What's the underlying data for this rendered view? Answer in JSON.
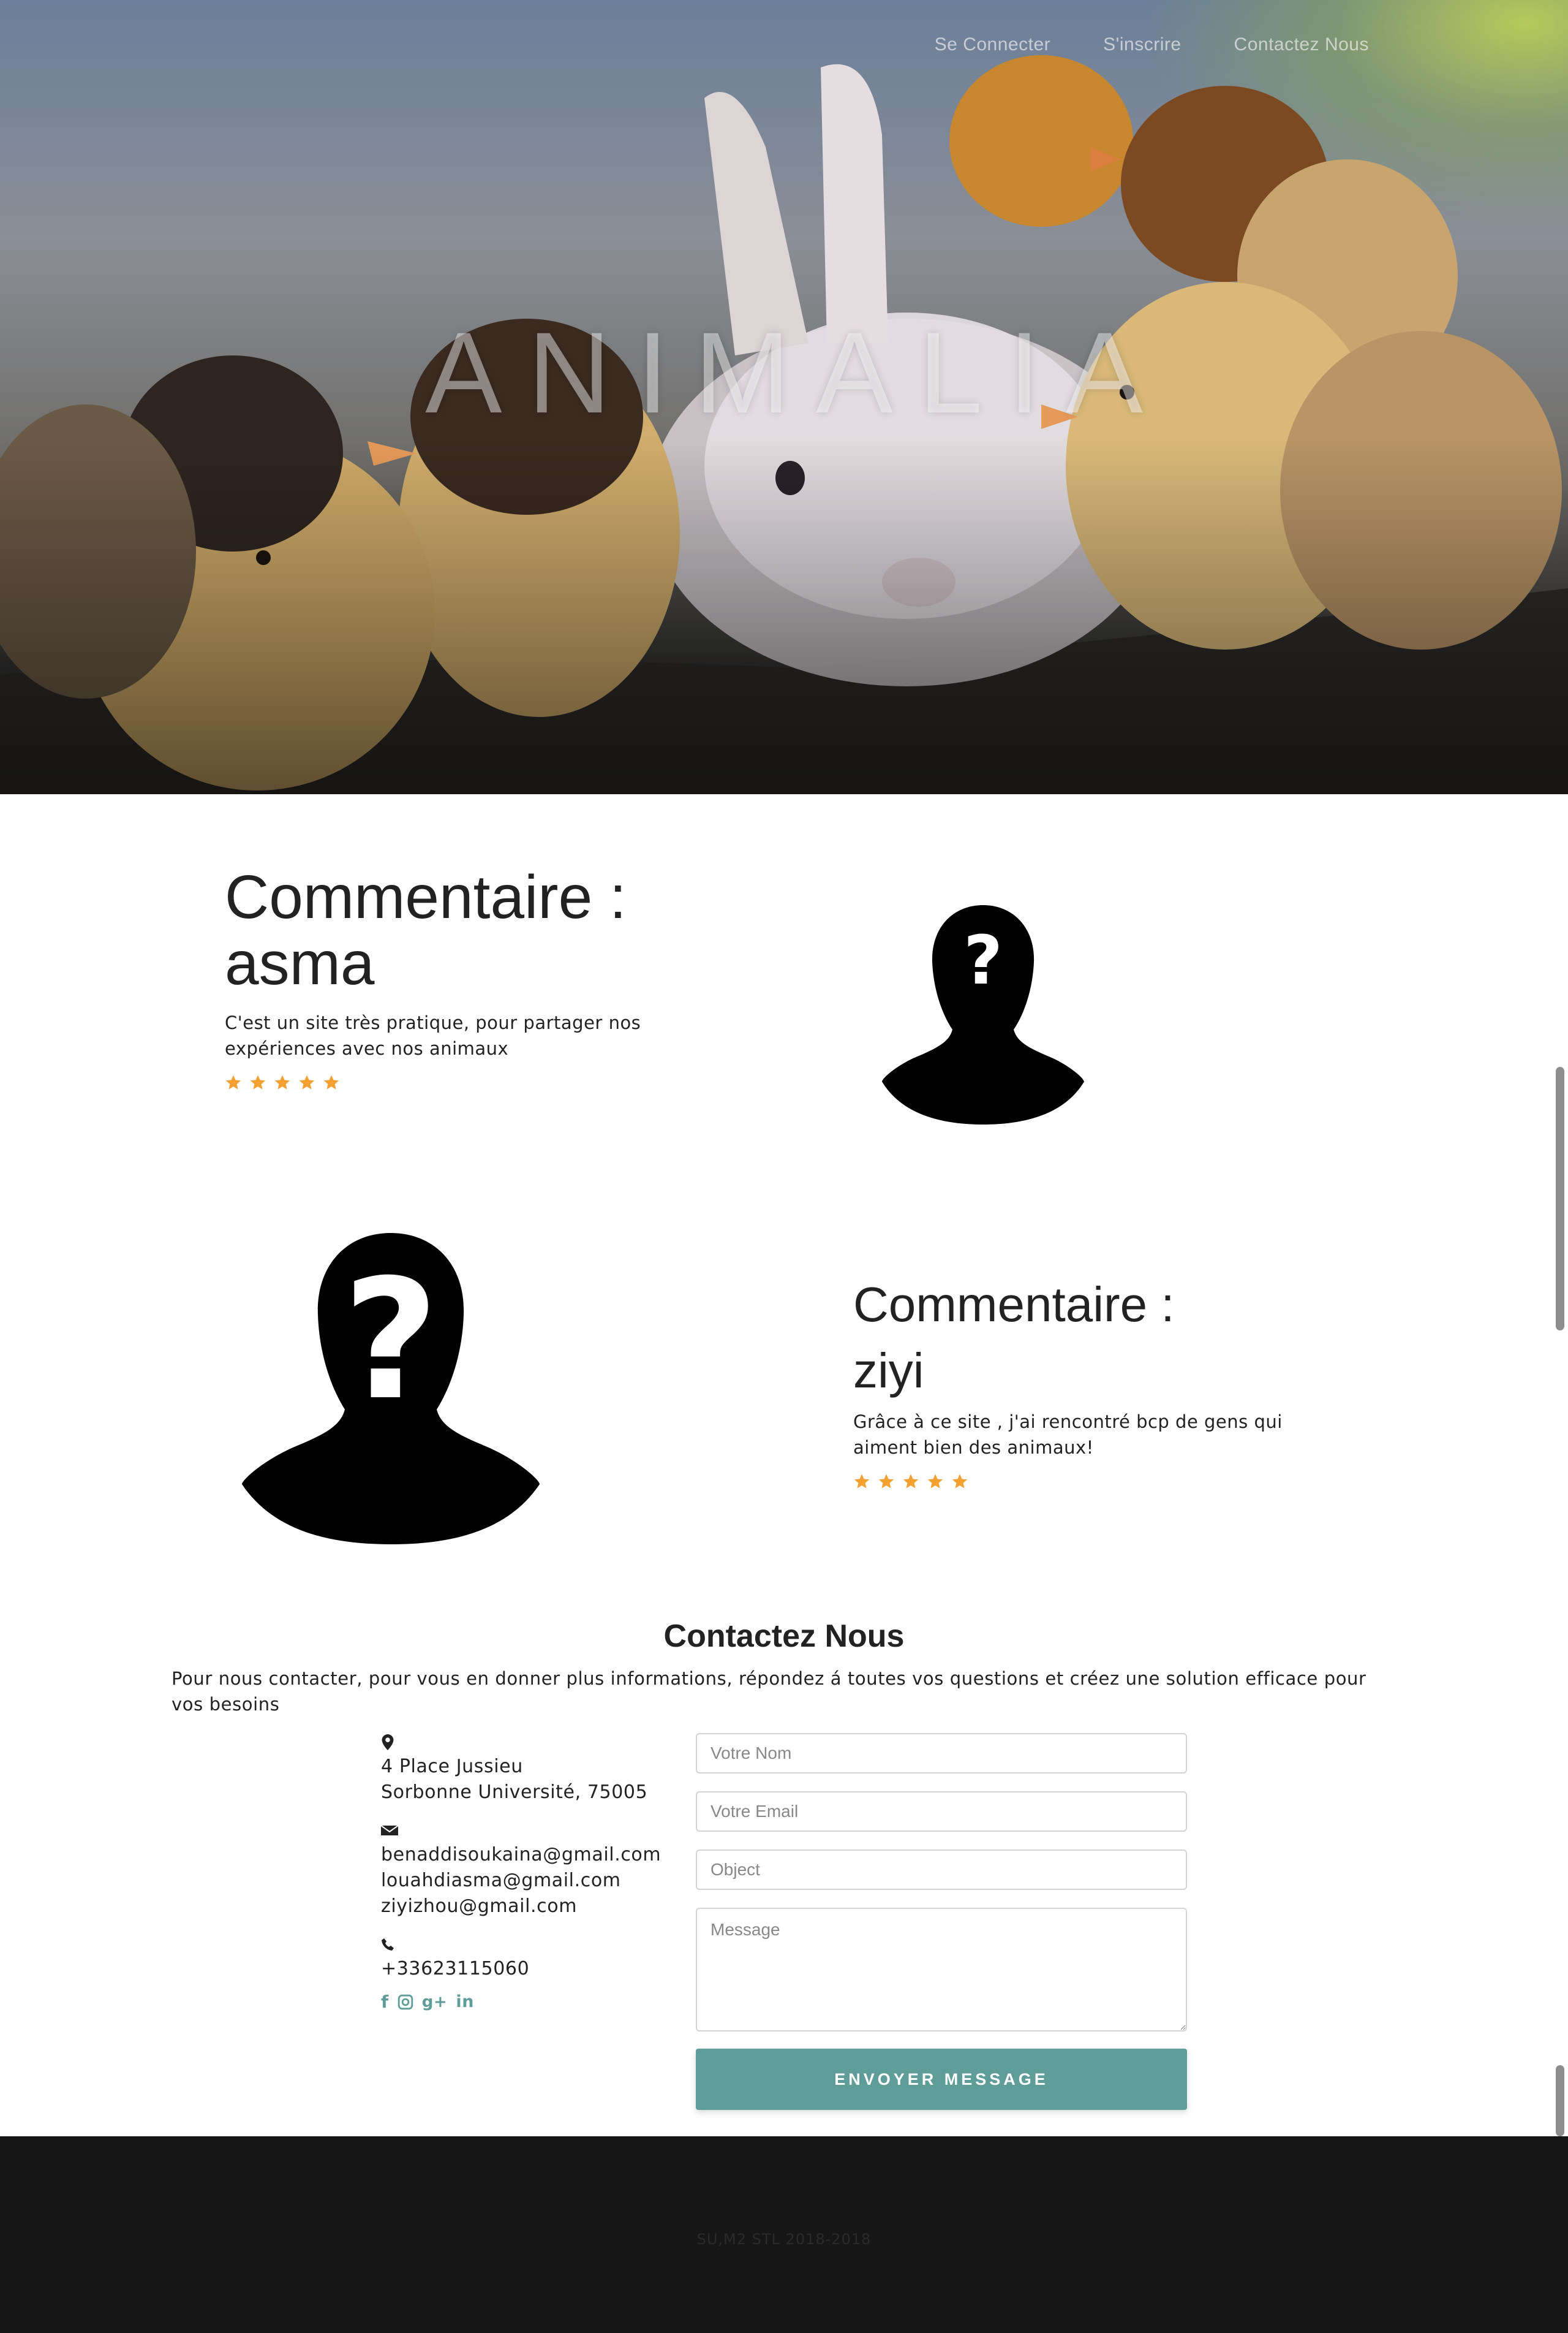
{
  "nav": {
    "items": [
      {
        "label": "Se Connecter"
      },
      {
        "label": "S'inscrire"
      },
      {
        "label": "Contactez Nous"
      }
    ]
  },
  "hero": {
    "title": "ANIMALIA"
  },
  "testimonials": [
    {
      "heading": "Commentaire :",
      "name": "asma",
      "text": "C'est un site très pratique, pour partager nos expériences avec nos animaux",
      "rating": 5
    },
    {
      "heading": "Commentaire :",
      "name": "ziyi",
      "text": "Grâce à ce site , j'ai rencontré bcp de gens qui aiment bien des animaux!",
      "rating": 5
    }
  ],
  "contact": {
    "title": "Contactez Nous",
    "intro": "Pour nous contacter, pour vous en donner plus informations, répondez á toutes vos questions et créez une solution efficace pour vos besoins",
    "address": {
      "icon": "map-marker-icon",
      "line1": "4 Place Jussieu",
      "line2": "Sorbonne Université, 75005"
    },
    "emails": {
      "icon": "envelope-icon",
      "list": [
        "benaddisoukaina@gmail.com",
        "louahdiasma@gmail.com",
        "ziyizhou@gmail.com"
      ]
    },
    "phone": {
      "icon": "phone-icon",
      "number": "+33623115060"
    },
    "social": [
      "facebook-icon",
      "instagram-icon",
      "google-plus-icon",
      "linkedin-icon"
    ],
    "form": {
      "name_placeholder": "Votre Nom",
      "email_placeholder": "Votre Email",
      "object_placeholder": "Object",
      "message_placeholder": "Message",
      "submit_label": "ENVOYER MESSAGE"
    }
  },
  "footer": {
    "text": "SU,M2 STL 2018-2018"
  },
  "colors": {
    "accent": "#5f9e98",
    "star": "#f4a131",
    "footer_bg": "#161616"
  }
}
